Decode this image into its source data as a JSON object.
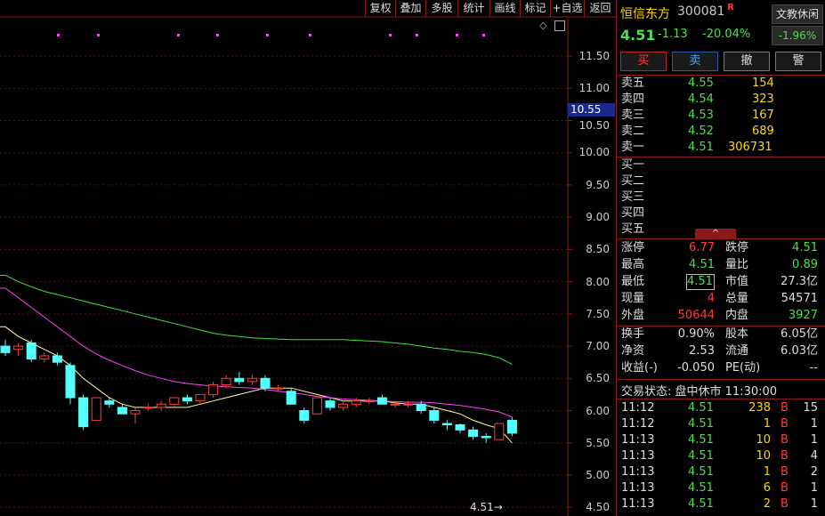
{
  "toolbar": {
    "items": [
      "复权",
      "叠加",
      "多股",
      "统计",
      "画线",
      "标记",
      "+自选",
      "返回"
    ]
  },
  "y_axis": {
    "ticks": [
      "11.50",
      "11.00",
      "10.55",
      "10.50",
      "10.00",
      "9.50",
      "9.00",
      "8.50",
      "8.00",
      "7.50",
      "7.00",
      "6.50",
      "6.00",
      "5.50",
      "5.00",
      "4.50"
    ],
    "current_marker": "10.55"
  },
  "last_price_tag": "4.51",
  "chart_data": {
    "type": "candlestick",
    "ylim": [
      4.5,
      11.6
    ],
    "candles": [
      {
        "o": 7.0,
        "h": 7.1,
        "l": 6.85,
        "c": 6.9
      },
      {
        "o": 6.95,
        "h": 7.05,
        "l": 6.85,
        "c": 7.0
      },
      {
        "o": 7.05,
        "h": 7.1,
        "l": 6.75,
        "c": 6.8
      },
      {
        "o": 6.8,
        "h": 6.9,
        "l": 6.75,
        "c": 6.85
      },
      {
        "o": 6.85,
        "h": 6.9,
        "l": 6.7,
        "c": 6.75
      },
      {
        "o": 6.7,
        "h": 6.75,
        "l": 6.1,
        "c": 6.2
      },
      {
        "o": 6.2,
        "h": 6.25,
        "l": 5.7,
        "c": 5.75
      },
      {
        "o": 5.85,
        "h": 6.2,
        "l": 5.85,
        "c": 6.2
      },
      {
        "o": 6.15,
        "h": 6.2,
        "l": 6.05,
        "c": 6.1
      },
      {
        "o": 6.05,
        "h": 6.1,
        "l": 5.95,
        "c": 5.95
      },
      {
        "o": 5.95,
        "h": 6.05,
        "l": 5.8,
        "c": 6.0
      },
      {
        "o": 6.05,
        "h": 6.1,
        "l": 6.0,
        "c": 6.05
      },
      {
        "o": 6.05,
        "h": 6.15,
        "l": 6.0,
        "c": 6.1
      },
      {
        "o": 6.1,
        "h": 6.2,
        "l": 6.05,
        "c": 6.2
      },
      {
        "o": 6.2,
        "h": 6.25,
        "l": 6.1,
        "c": 6.15
      },
      {
        "o": 6.15,
        "h": 6.25,
        "l": 6.1,
        "c": 6.25
      },
      {
        "o": 6.25,
        "h": 6.45,
        "l": 6.2,
        "c": 6.4
      },
      {
        "o": 6.4,
        "h": 6.55,
        "l": 6.35,
        "c": 6.5
      },
      {
        "o": 6.5,
        "h": 6.6,
        "l": 6.4,
        "c": 6.45
      },
      {
        "o": 6.45,
        "h": 6.55,
        "l": 6.4,
        "c": 6.5
      },
      {
        "o": 6.5,
        "h": 6.55,
        "l": 6.3,
        "c": 6.35
      },
      {
        "o": 6.35,
        "h": 6.4,
        "l": 6.3,
        "c": 6.35
      },
      {
        "o": 6.3,
        "h": 6.35,
        "l": 6.1,
        "c": 6.1
      },
      {
        "o": 6.0,
        "h": 6.05,
        "l": 5.8,
        "c": 5.85
      },
      {
        "o": 5.95,
        "h": 6.2,
        "l": 5.95,
        "c": 6.2
      },
      {
        "o": 6.15,
        "h": 6.2,
        "l": 6.0,
        "c": 6.05
      },
      {
        "o": 6.05,
        "h": 6.15,
        "l": 6.0,
        "c": 6.1
      },
      {
        "o": 6.1,
        "h": 6.2,
        "l": 6.05,
        "c": 6.15
      },
      {
        "o": 6.15,
        "h": 6.2,
        "l": 6.1,
        "c": 6.15
      },
      {
        "o": 6.2,
        "h": 6.25,
        "l": 6.1,
        "c": 6.1
      },
      {
        "o": 6.1,
        "h": 6.15,
        "l": 6.05,
        "c": 6.1
      },
      {
        "o": 6.1,
        "h": 6.15,
        "l": 6.05,
        "c": 6.1
      },
      {
        "o": 6.1,
        "h": 6.15,
        "l": 5.95,
        "c": 6.0
      },
      {
        "o": 6.0,
        "h": 6.05,
        "l": 5.8,
        "c": 5.85
      },
      {
        "o": 5.8,
        "h": 5.85,
        "l": 5.7,
        "c": 5.78
      },
      {
        "o": 5.78,
        "h": 5.8,
        "l": 5.65,
        "c": 5.7
      },
      {
        "o": 5.7,
        "h": 5.75,
        "l": 5.55,
        "c": 5.6
      },
      {
        "o": 5.6,
        "h": 5.65,
        "l": 5.5,
        "c": 5.58
      },
      {
        "o": 5.55,
        "h": 5.8,
        "l": 5.55,
        "c": 5.8
      },
      {
        "o": 5.85,
        "h": 5.9,
        "l": 5.6,
        "c": 5.65
      }
    ],
    "ma_lines": [
      {
        "color": "#ffffa0",
        "values": [
          7.3,
          7.15,
          7.05,
          6.95,
          6.85,
          6.7,
          6.5,
          6.35,
          6.2,
          6.1,
          6.05,
          6.05,
          6.05,
          6.05,
          6.05,
          6.1,
          6.15,
          6.2,
          6.25,
          6.3,
          6.35,
          6.35,
          6.35,
          6.3,
          6.25,
          6.2,
          6.15,
          6.15,
          6.15,
          6.15,
          6.12,
          6.1,
          6.1,
          6.05,
          6.0,
          5.95,
          5.85,
          5.78,
          5.72,
          5.5
        ]
      },
      {
        "color": "#ff40ff",
        "values": [
          7.9,
          7.75,
          7.6,
          7.45,
          7.3,
          7.15,
          7.0,
          6.88,
          6.78,
          6.7,
          6.62,
          6.55,
          6.5,
          6.45,
          6.42,
          6.4,
          6.38,
          6.37,
          6.36,
          6.35,
          6.33,
          6.3,
          6.28,
          6.25,
          6.22,
          6.2,
          6.18,
          6.17,
          6.16,
          6.15,
          6.14,
          6.13,
          6.13,
          6.12,
          6.1,
          6.08,
          6.05,
          6.02,
          5.98,
          5.9
        ]
      },
      {
        "color": "#40e040",
        "values": [
          8.1,
          8.0,
          7.92,
          7.85,
          7.8,
          7.75,
          7.7,
          7.65,
          7.6,
          7.55,
          7.5,
          7.45,
          7.4,
          7.35,
          7.3,
          7.25,
          7.2,
          7.17,
          7.15,
          7.13,
          7.12,
          7.11,
          7.1,
          7.1,
          7.1,
          7.1,
          7.1,
          7.09,
          7.08,
          7.07,
          7.05,
          7.03,
          7.0,
          6.97,
          6.95,
          6.92,
          6.9,
          6.87,
          6.82,
          6.72
        ]
      }
    ]
  },
  "stock": {
    "name": "恒信东方",
    "code": "300081",
    "badge": "R",
    "price": "4.51",
    "change": "-1.13",
    "change_pct": "-20.04%",
    "sector": "文教休闲",
    "sector_pct": "-1.96%"
  },
  "buttons": [
    "买",
    "卖",
    "撤",
    "警"
  ],
  "asks": [
    {
      "label": "卖五",
      "price": "4.55",
      "vol": "154"
    },
    {
      "label": "卖四",
      "price": "4.54",
      "vol": "323"
    },
    {
      "label": "卖三",
      "price": "4.53",
      "vol": "167"
    },
    {
      "label": "卖二",
      "price": "4.52",
      "vol": "689"
    },
    {
      "label": "卖一",
      "price": "4.51",
      "vol": "306731"
    }
  ],
  "bids": [
    {
      "label": "买一"
    },
    {
      "label": "买二"
    },
    {
      "label": "买三"
    },
    {
      "label": "买四"
    },
    {
      "label": "买五"
    }
  ],
  "stats1": [
    {
      "l1": "涨停",
      "v1": "6.77",
      "l2": "跌停",
      "v2": "4.51"
    },
    {
      "l1": "最高",
      "v1": "4.51",
      "l2": "量比",
      "v2": "0.89"
    },
    {
      "l1": "最低",
      "v1": "4.51",
      "l2": "市值",
      "v2": "27.3亿"
    },
    {
      "l1": "现量",
      "v1": "4",
      "l2": "总量",
      "v2": "54571"
    },
    {
      "l1": "外盘",
      "v1": "50644",
      "l2": "内盘",
      "v2": "3927"
    }
  ],
  "stats2": [
    {
      "l1": "换手",
      "v1": "0.90%",
      "l2": "股本",
      "v2": "6.05亿"
    },
    {
      "l1": "净资",
      "v1": "2.53",
      "l2": "流通",
      "v2": "6.03亿"
    },
    {
      "l1": "收益(-)",
      "v1": "-0.050",
      "l2": "PE(动)",
      "v2": "--"
    }
  ],
  "status": "交易状态: 盘中休市 11:30:00",
  "ticks": [
    {
      "t": "11:12",
      "p": "4.51",
      "v": "238",
      "s": "B",
      "n": "15"
    },
    {
      "t": "11:12",
      "p": "4.51",
      "v": "1",
      "s": "B",
      "n": "1"
    },
    {
      "t": "11:13",
      "p": "4.51",
      "v": "10",
      "s": "B",
      "n": "1"
    },
    {
      "t": "11:13",
      "p": "4.51",
      "v": "10",
      "s": "B",
      "n": "4"
    },
    {
      "t": "11:13",
      "p": "4.51",
      "v": "1",
      "s": "B",
      "n": "2"
    },
    {
      "t": "11:13",
      "p": "4.51",
      "v": "6",
      "s": "B",
      "n": "1"
    },
    {
      "t": "11:13",
      "p": "4.51",
      "v": "2",
      "s": "B",
      "n": "1"
    }
  ]
}
